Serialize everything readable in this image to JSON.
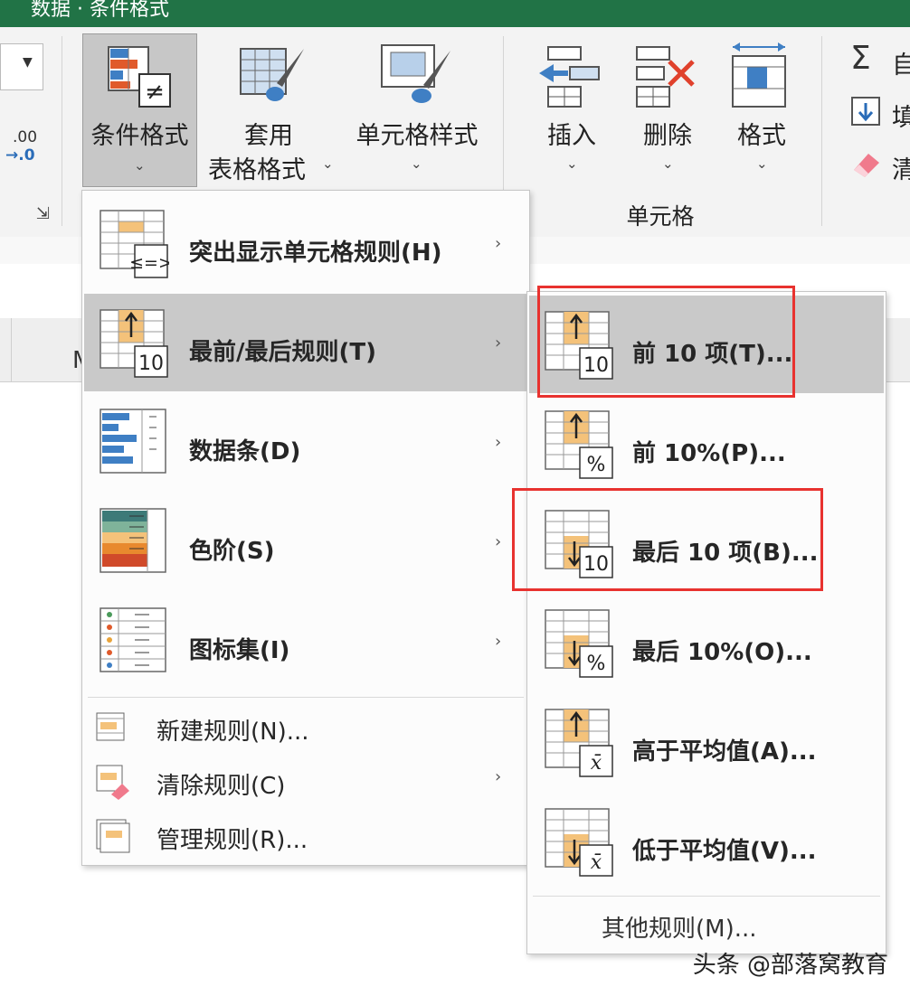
{
  "window": {
    "title": "数据 · 条件格式"
  },
  "ribbon": {
    "number_decimals": ".00",
    "number_decimals_2": "→.0",
    "cond_format_label": "条件格式",
    "table_format_line1": "套用",
    "table_format_line2": "表格格式",
    "cell_styles_label": "单元格样式",
    "insert_label": "插入",
    "delete_label": "删除",
    "format_label": "格式",
    "cells_group_label": "单元格",
    "autosum_label": "自",
    "fill_label": "填",
    "clear_label": "清",
    "dropdown_glyph": "⌄",
    "launcher_glyph": "⇲"
  },
  "sheet": {
    "col_header_fragment": "M"
  },
  "main_menu": {
    "items": [
      {
        "label": "突出显示单元格规则(H)"
      },
      {
        "label": "最前/最后规则(T)"
      },
      {
        "label": "数据条(D)"
      },
      {
        "label": "色阶(S)"
      },
      {
        "label": "图标集(I)"
      },
      {
        "label": "新建规则(N)..."
      },
      {
        "label": "清除规则(C)"
      },
      {
        "label": "管理规则(R)..."
      }
    ],
    "submenu_arrow": "›"
  },
  "sub_menu": {
    "items": [
      {
        "label": "前 10 项(T)..."
      },
      {
        "label": "前 10%(P)..."
      },
      {
        "label": "最后 10 项(B)..."
      },
      {
        "label": "最后 10%(O)..."
      },
      {
        "label": "高于平均值(A)..."
      },
      {
        "label": "低于平均值(V)..."
      }
    ],
    "more_rules": "其他规则(M)..."
  },
  "icon_text": {
    "ten": "10",
    "percent": "%",
    "xbar": "x̄",
    "neq": "≠",
    "lege": "≤=>"
  },
  "watermark": "头条 @部落窝教育",
  "colors": {
    "accent": "#217346",
    "highlight": "#c9c9c9",
    "annotation": "#e8322f",
    "orange": "#f4c27a",
    "blue": "#3f7fc4"
  }
}
